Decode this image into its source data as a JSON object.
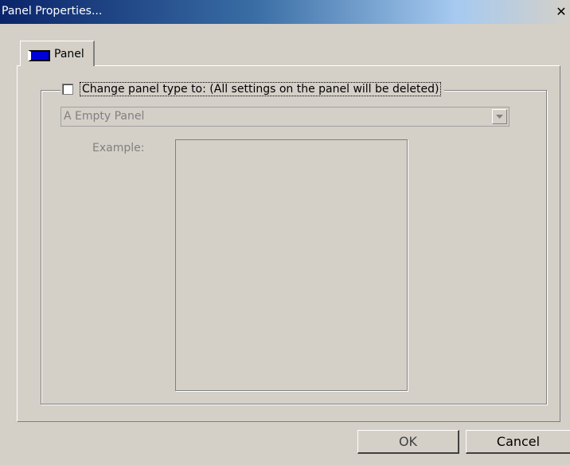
{
  "window": {
    "title": "Panel Properties...",
    "close_glyph": "✕"
  },
  "tabs": [
    {
      "label": "Panel",
      "icon": "panel-icon",
      "selected": true
    }
  ],
  "group": {
    "checkbox_checked": false,
    "checkbox_label": "Change panel type to: (All settings on the panel will be deleted)"
  },
  "panel_type_select": {
    "value": "A Empty Panel",
    "enabled": false
  },
  "example": {
    "label": "Example:"
  },
  "buttons": {
    "ok": "OK",
    "cancel": "Cancel"
  },
  "colors": {
    "title_start": "#0a246a",
    "face": "#d4d0c8",
    "panel_icon": "#0000d8"
  }
}
